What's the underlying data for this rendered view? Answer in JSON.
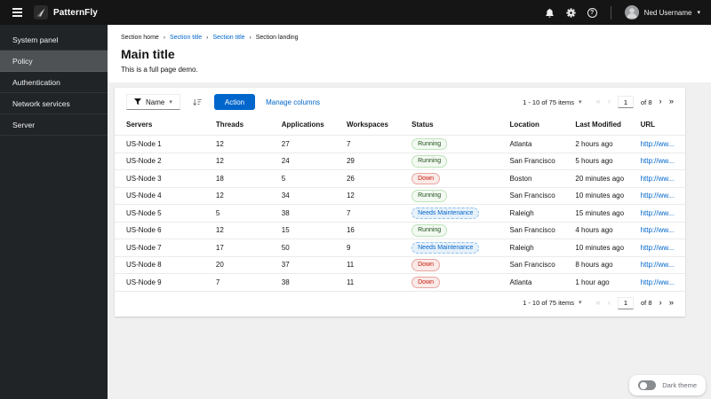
{
  "masthead": {
    "brand": "PatternFly",
    "user": "Ned Username"
  },
  "sidebar": {
    "items": [
      {
        "label": "System panel",
        "selected": false
      },
      {
        "label": "Policy",
        "selected": true
      },
      {
        "label": "Authentication",
        "selected": false
      },
      {
        "label": "Network services",
        "selected": false
      },
      {
        "label": "Server",
        "selected": false
      }
    ]
  },
  "breadcrumb": {
    "items": [
      {
        "label": "Section home",
        "link": false
      },
      {
        "label": "Section title",
        "link": true
      },
      {
        "label": "Section title",
        "link": true
      },
      {
        "label": "Section landing",
        "link": false
      }
    ]
  },
  "page": {
    "title": "Main title",
    "description": "This is a full page demo."
  },
  "toolbar": {
    "filter_label": "Name",
    "action_label": "Action",
    "manage_columns_label": "Manage columns"
  },
  "pagination": {
    "summary": "1 - 10 of 75 items",
    "page": "1",
    "of_label": "of 8"
  },
  "glyphs": {
    "caret": "▾",
    "breadcrumb_sep": "›",
    "first": "«",
    "prev": "‹",
    "next": "›",
    "last": "»",
    "help": "?"
  },
  "table": {
    "columns": [
      "Servers",
      "Threads",
      "Applications",
      "Workspaces",
      "Status",
      "Location",
      "Last Modified",
      "URL"
    ],
    "rows": [
      {
        "server": "US-Node 1",
        "threads": "12",
        "applications": "27",
        "workspaces": "7",
        "status": "Running",
        "status_type": "green",
        "location": "Atlanta",
        "modified": "2 hours ago",
        "url": "http://ww..."
      },
      {
        "server": "US-Node 2",
        "threads": "12",
        "applications": "24",
        "workspaces": "29",
        "status": "Running",
        "status_type": "green",
        "location": "San Francisco",
        "modified": "5 hours ago",
        "url": "http://ww..."
      },
      {
        "server": "US-Node 3",
        "threads": "18",
        "applications": "5",
        "workspaces": "26",
        "status": "Down",
        "status_type": "red",
        "location": "Boston",
        "modified": "20 minutes ago",
        "url": "http://ww..."
      },
      {
        "server": "US-Node 4",
        "threads": "12",
        "applications": "34",
        "workspaces": "12",
        "status": "Running",
        "status_type": "green",
        "location": "San Francisco",
        "modified": "10 minutes ago",
        "url": "http://ww..."
      },
      {
        "server": "US-Node 5",
        "threads": "5",
        "applications": "38",
        "workspaces": "7",
        "status": "Needs Maintenance",
        "status_type": "blue",
        "location": "Raleigh",
        "modified": "15 minutes ago",
        "url": "http://ww..."
      },
      {
        "server": "US-Node 6",
        "threads": "12",
        "applications": "15",
        "workspaces": "16",
        "status": "Running",
        "status_type": "green",
        "location": "San Francisco",
        "modified": "4 hours ago",
        "url": "http://ww..."
      },
      {
        "server": "US-Node 7",
        "threads": "17",
        "applications": "50",
        "workspaces": "9",
        "status": "Needs Maintenance",
        "status_type": "blue",
        "location": "Raleigh",
        "modified": "10 minutes ago",
        "url": "http://ww..."
      },
      {
        "server": "US-Node 8",
        "threads": "20",
        "applications": "37",
        "workspaces": "11",
        "status": "Down",
        "status_type": "red",
        "location": "San Francisco",
        "modified": "8 hours ago",
        "url": "http://ww..."
      },
      {
        "server": "US-Node 9",
        "threads": "7",
        "applications": "38",
        "workspaces": "11",
        "status": "Down",
        "status_type": "red",
        "location": "Atlanta",
        "modified": "1 hour ago",
        "url": "http://ww..."
      }
    ]
  },
  "theme_toggle": {
    "label": "Dark theme",
    "on": false
  },
  "colors": {
    "primary": "#0066cc",
    "masthead_bg": "#151515",
    "sidebar_bg": "#212427",
    "sidebar_selected": "#4f5255",
    "content_bg": "#f0f0f0",
    "status_green": "#1e4f18",
    "status_red": "#c9190b",
    "status_blue": "#0066cc"
  }
}
